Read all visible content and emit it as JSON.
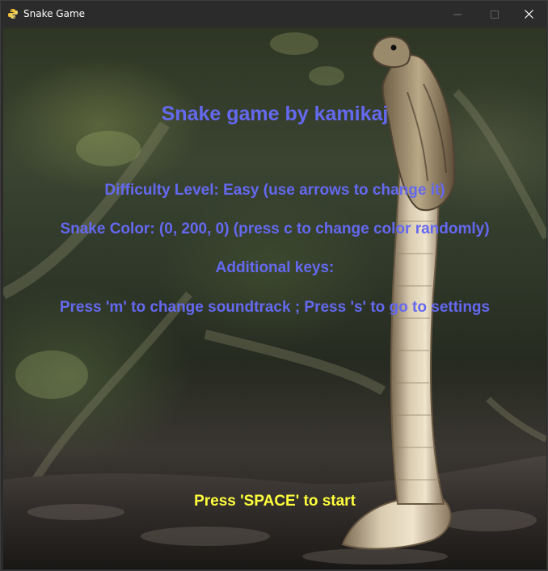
{
  "window": {
    "title": "Snake Game",
    "app_icon": "python-icon",
    "controls": {
      "minimize_icon": "minimize-icon",
      "maximize_icon": "maximize-icon",
      "close_icon": "close-icon"
    }
  },
  "game": {
    "background": "cobra-photo",
    "title": "Snake game by kamikaj",
    "difficulty_line": "Difficulty Level: Easy (use arrows to change it)",
    "snake_color_line": "Snake Color: (0, 200, 0) (press c to change color randomly)",
    "additional_keys_label": "Additional keys:",
    "keys_line": "Press 'm' to change soundtrack ; Press 's' to go to settings",
    "start_prompt": "Press 'SPACE' to start",
    "colors": {
      "menu_text": "#6469f0",
      "start_text": "#ffff3c"
    }
  }
}
